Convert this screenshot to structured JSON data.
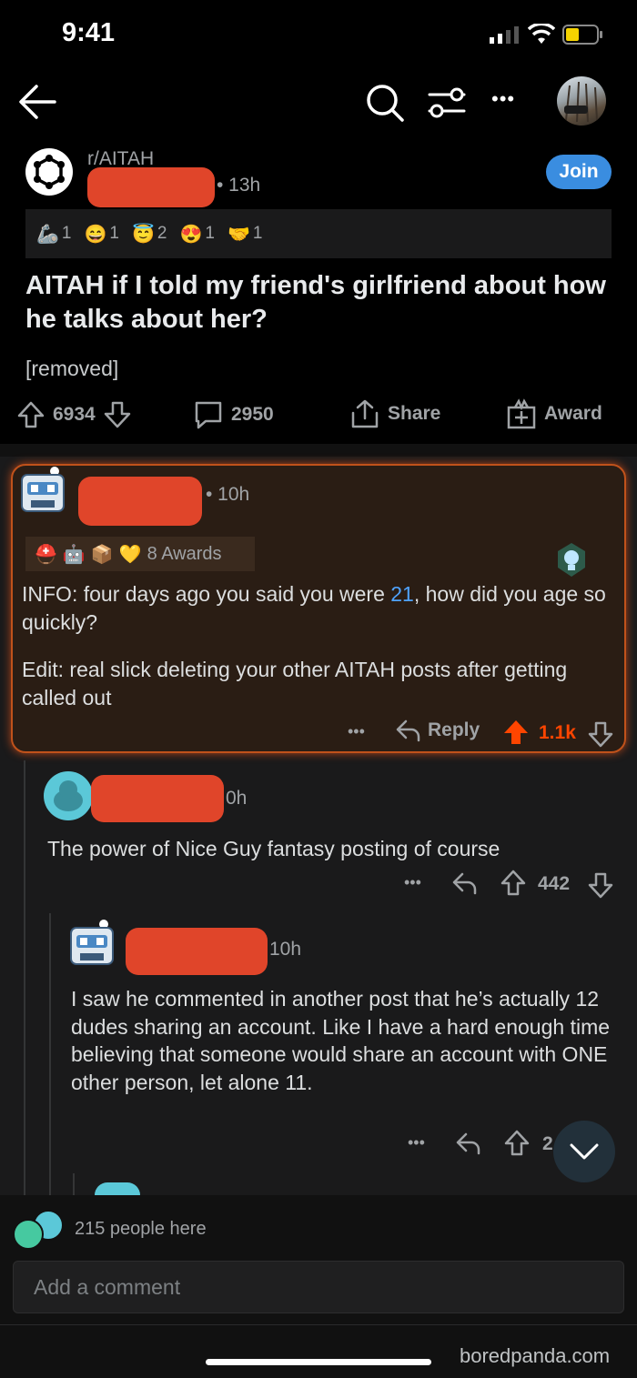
{
  "status": {
    "time": "9:41"
  },
  "nav": {
    "back_icon": "back-arrow-icon",
    "search_icon": "search-icon",
    "filter_icon": "sort-sliders-icon",
    "more_icon": "more-dots-icon",
    "more_label": "•••"
  },
  "post": {
    "subreddit": "r/AITAH",
    "time": "• 13h",
    "join_label": "Join",
    "awards": [
      {
        "count": "1"
      },
      {
        "count": "1"
      },
      {
        "count": "2"
      },
      {
        "count": "1"
      },
      {
        "count": "1"
      }
    ],
    "title": "AITAH if I told my friend's girlfriend about how he talks about her?",
    "body": "[removed]",
    "score": "6934",
    "comments": "2950",
    "share_label": "Share",
    "award_label": "Award"
  },
  "comments": [
    {
      "time": "• 10h",
      "awards_label": "8 Awards",
      "text_pre": "INFO: four days ago you said you were ",
      "text_link": "21",
      "text_post": ", how did you age so quickly?",
      "edit": "Edit: real slick deleting your other AITAH posts after getting called out",
      "more_label": "•••",
      "reply_label": "Reply",
      "score": "1.1k"
    },
    {
      "time": "0h",
      "text": "The power of Nice Guy fantasy posting of course",
      "more_label": "•••",
      "score": "442"
    },
    {
      "time": "10h",
      "text": "I saw he commented in another post that he’s actually 12 dudes sharing an account. Like I have a hard enough time believing that someone would share an account with ONE other person, let alone 11.",
      "more_label": "•••",
      "score": "2"
    }
  ],
  "footer": {
    "people_here": "215 people here",
    "add_comment_placeholder": "Add a comment",
    "watermark": "boredpanda.com"
  },
  "colors": {
    "accent": "#3a8de0",
    "upvote": "#ff4500",
    "redaction": "#e0452a",
    "highlight_border": "#c0521b"
  }
}
